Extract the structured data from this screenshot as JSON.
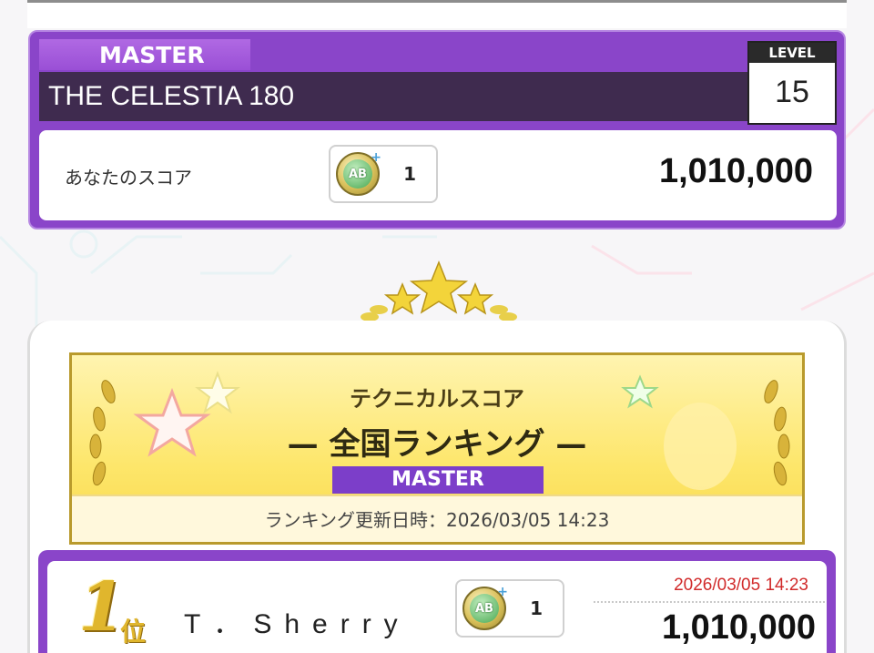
{
  "song": {
    "difficulty": "MASTER",
    "title": "THE CELESTIA 180",
    "level_label": "LEVEL",
    "level": "15",
    "score_label": "あなたのスコア",
    "rank_badge": "AB",
    "rank_count": "1",
    "score": "1,010,000"
  },
  "ranking": {
    "subtitle": "テクニカルスコア",
    "title": "— 全国ランキング —",
    "difficulty_tag": "MASTER",
    "updated": "ランキング更新日時：2026/03/05 14:23"
  },
  "entries": [
    {
      "place": "1",
      "place_suffix": "位",
      "name": "T．Sherry",
      "rank_badge": "AB",
      "rank_count": "1",
      "date": "2026/03/05 14:23",
      "score": "1,010,000"
    }
  ],
  "colors": {
    "master_purple": "#8a45c9",
    "title_bar": "#3f2b4f",
    "banner_gold": "#fde66a",
    "date_red": "#d12a2a"
  }
}
